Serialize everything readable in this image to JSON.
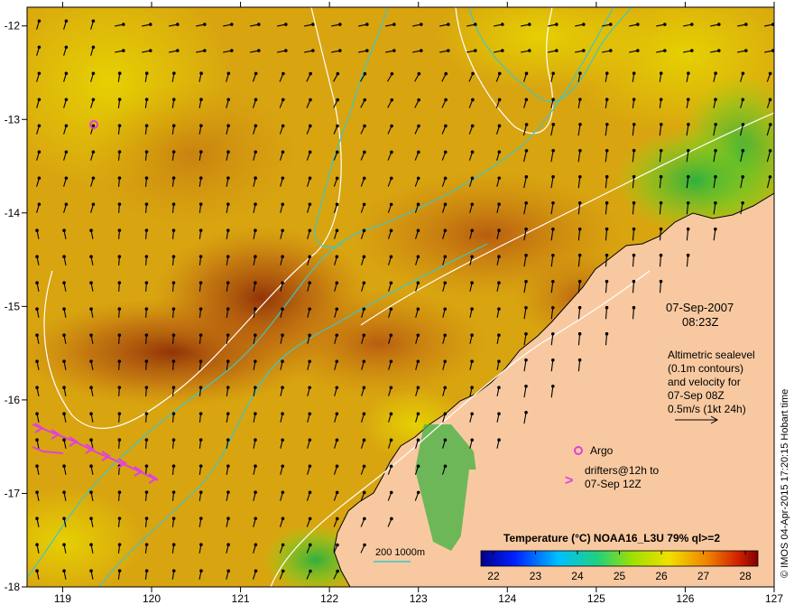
{
  "map": {
    "lon_ticks": [
      "119",
      "120",
      "121",
      "122",
      "123",
      "124",
      "125",
      "126",
      "127"
    ],
    "lat_ticks": [
      "-12",
      "-13",
      "-14",
      "-15",
      "-16",
      "-17",
      "-18"
    ],
    "lon_range": [
      118.6,
      127.0
    ],
    "lat_range": [
      -18.0,
      -11.8
    ]
  },
  "info": {
    "date": "07-Sep-2007",
    "time": "08:23Z",
    "altimetry_lines": [
      "Altimetric sealevel",
      "(0.1m contours)",
      "and velocity for",
      "07-Sep 08Z"
    ],
    "velocity_scale": "0.5m/s (1kt 24h)",
    "argo_label": "Argo",
    "drifter_lines": [
      "drifters@12h to",
      "07-Sep 12Z"
    ]
  },
  "isobath_label": "200  1000m",
  "colorbar": {
    "title": "Temperature (°C) NOAA16_L3U 79% ql>=2",
    "ticks": [
      "22",
      "23",
      "24",
      "25",
      "26",
      "27",
      "28"
    ],
    "range": [
      21.7,
      28.3
    ]
  },
  "credit": "© IMOS 04-Apr-2015 17:20:15 Hobart time",
  "colors": {
    "land": "#f8c9a0",
    "isobath": "#3fc6c8",
    "sealevel_contour": "#ffffff",
    "argo": "#e040e0",
    "drifter": "#e040e0",
    "sst_warm": "#9a3a08",
    "sst_mid": "#e0b000",
    "sst_cool": "#30b030"
  }
}
